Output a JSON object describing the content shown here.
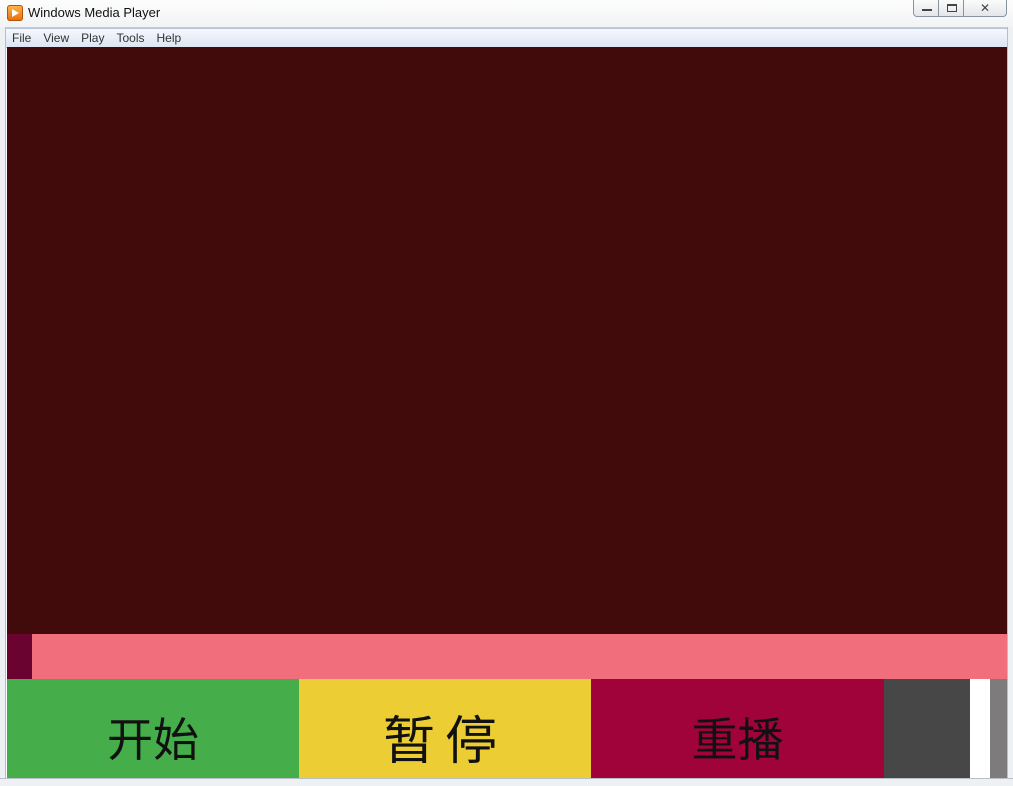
{
  "window": {
    "title": "Windows Media Player"
  },
  "menu": [
    {
      "label": "File"
    },
    {
      "label": "View"
    },
    {
      "label": "Play"
    },
    {
      "label": "Tools"
    },
    {
      "label": "Help"
    }
  ],
  "colors": {
    "video_background": "#410a0b",
    "progress_track": "#f16f7d",
    "progress_fill": "#6b0331",
    "start_button": "#45ae4b",
    "pause_button": "#eccd34",
    "replay_button": "#a0023a",
    "volume_background": "#474747"
  },
  "playback": {
    "progress_fraction": 0.025
  },
  "controls": {
    "start_label": "开始",
    "pause_label": "暂停",
    "replay_label": "重播",
    "volume_fraction": 0.7
  }
}
